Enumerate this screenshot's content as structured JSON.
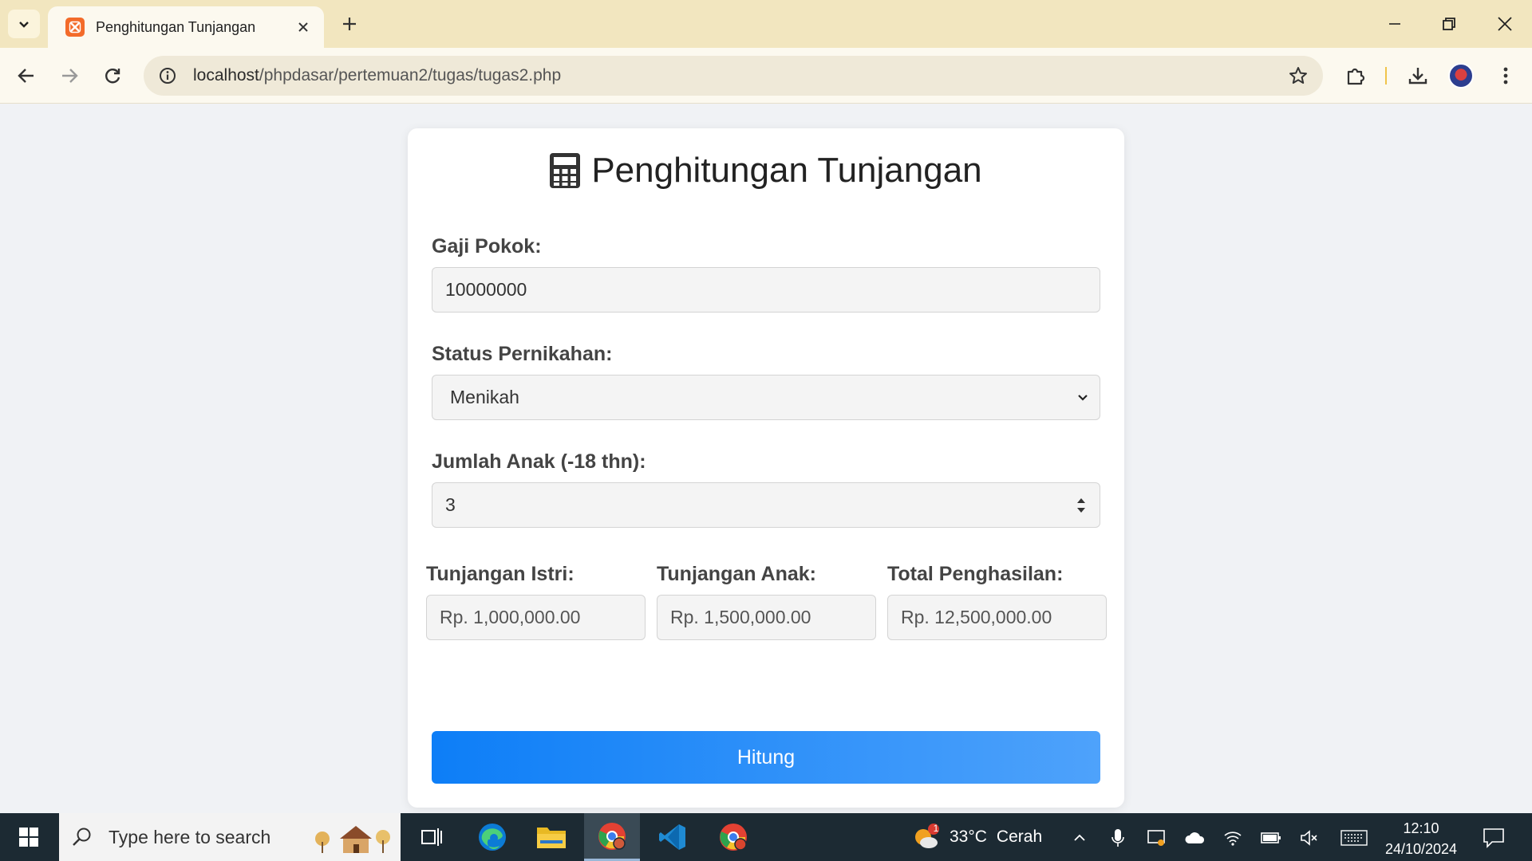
{
  "browser": {
    "tab_title": "Penghitungan Tunjangan",
    "url_host": "localhost",
    "url_path": "/phpdasar/pertemuan2/tugas/tugas2.php"
  },
  "page": {
    "title": "Penghitungan Tunjangan",
    "title_icon": "calculator-icon",
    "gaji_pokok": {
      "label": "Gaji Pokok:",
      "value": "10000000"
    },
    "status": {
      "label": "Status Pernikahan:",
      "value": "Menikah"
    },
    "jumlah_anak": {
      "label": "Jumlah Anak (-18 thn):",
      "value": "3"
    },
    "tunjangan_istri": {
      "label": "Tunjangan Istri:",
      "value": "Rp. 1,000,000.00"
    },
    "tunjangan_anak": {
      "label": "Tunjangan Anak:",
      "value": "Rp. 1,500,000.00"
    },
    "total": {
      "label": "Total Penghasilan:",
      "value": "Rp. 12,500,000.00"
    },
    "submit_label": "Hitung"
  },
  "taskbar": {
    "search_placeholder": "Type here to search",
    "weather_temp": "33°C",
    "weather_text": "Cerah",
    "weather_badge": "1",
    "time": "12:10",
    "date": "24/10/2024"
  },
  "colors": {
    "accent": "#0d7ef7",
    "titlebar": "#f2e6bf",
    "taskbar": "#1c2a33"
  }
}
